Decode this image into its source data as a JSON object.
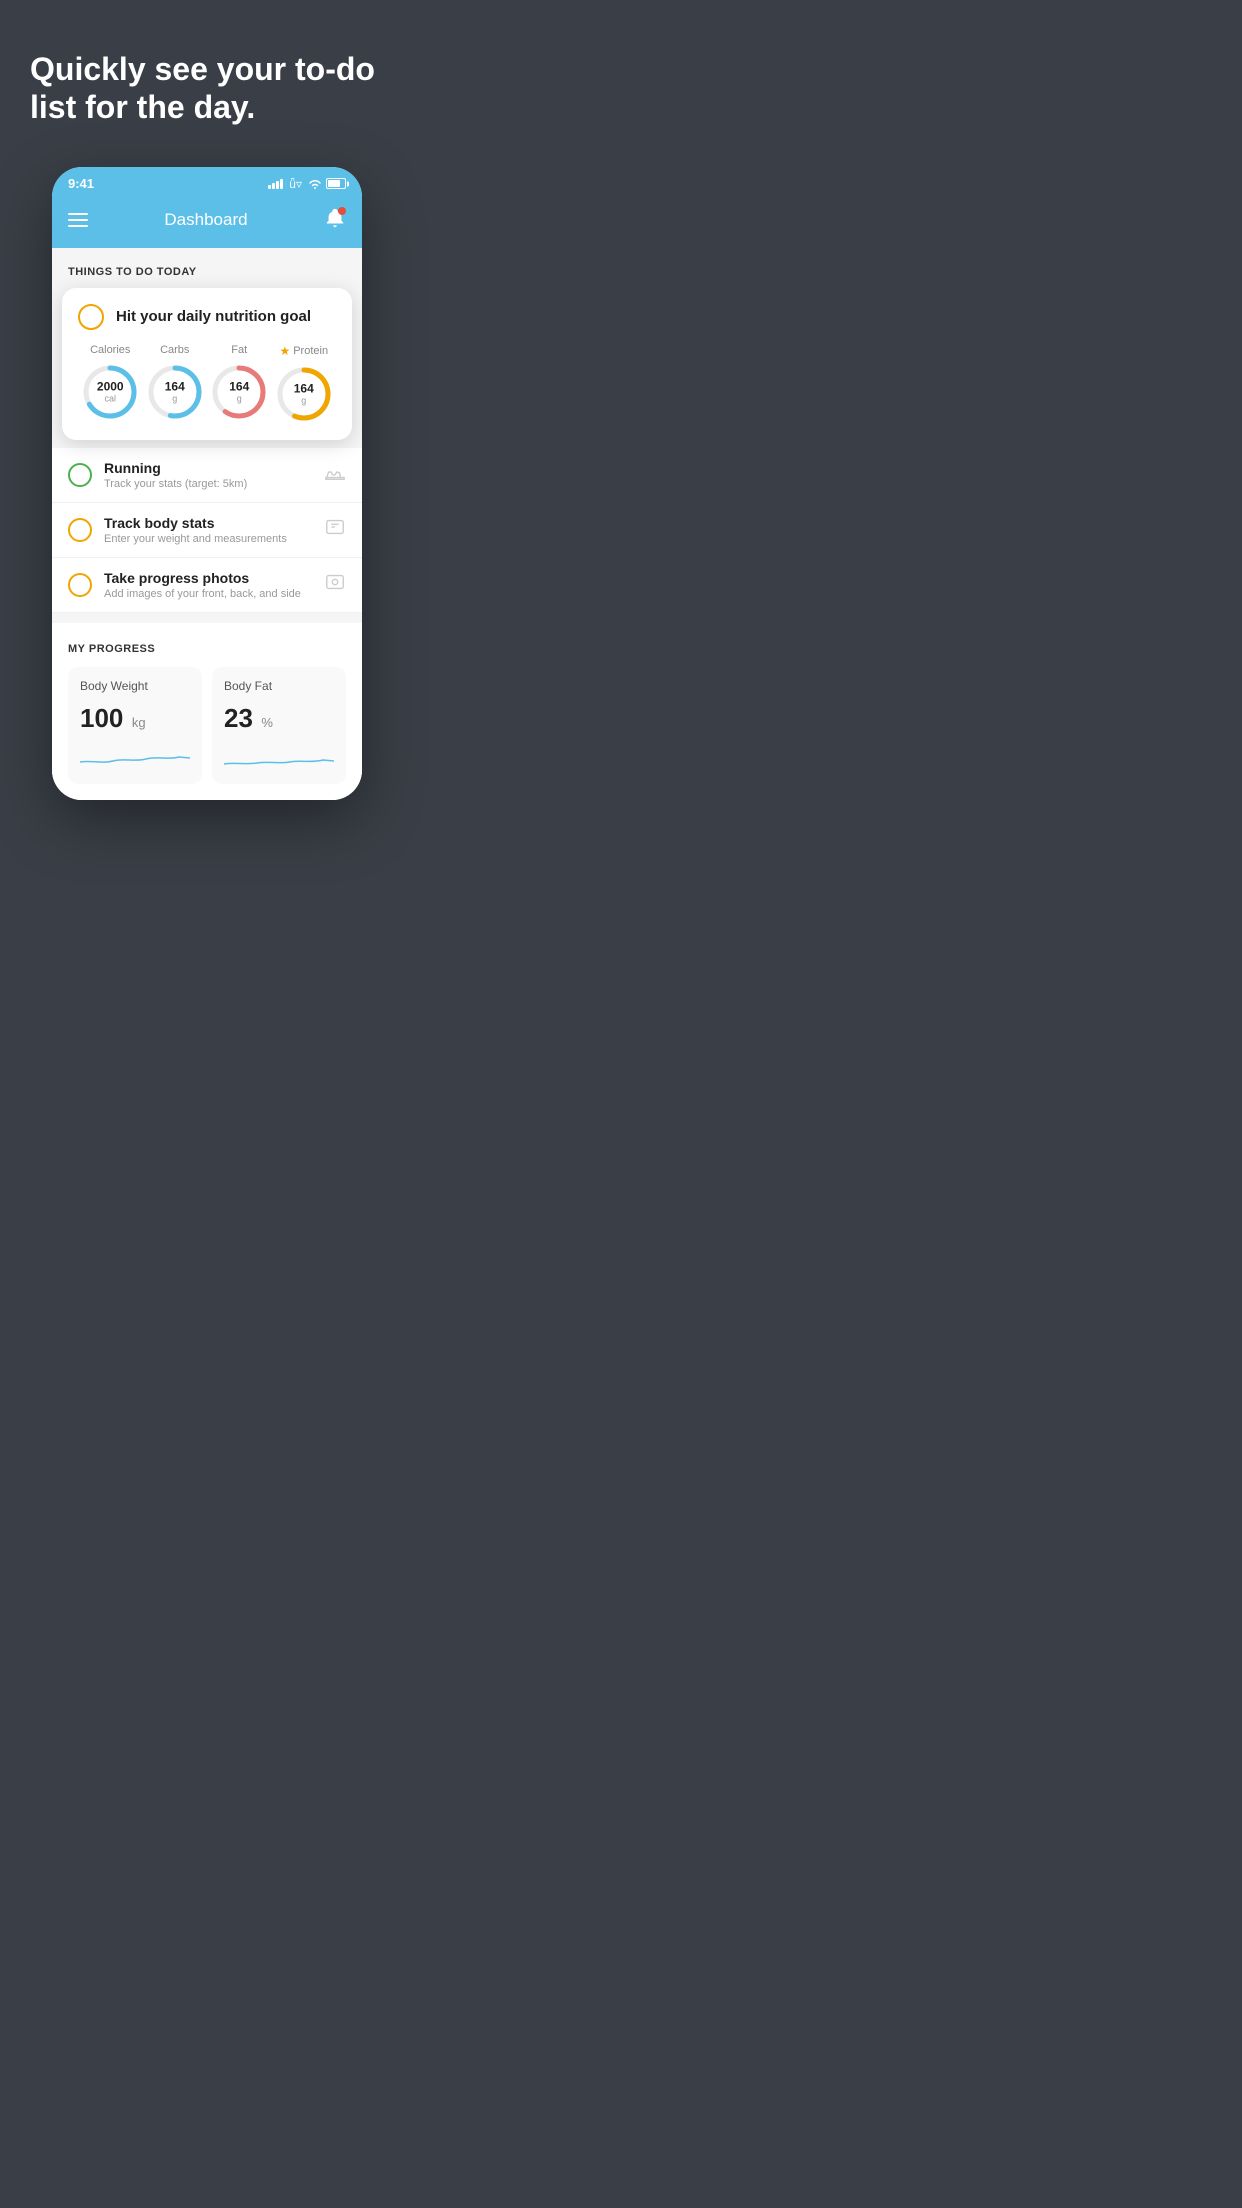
{
  "hero": {
    "text": "Quickly see your to-do list for the day."
  },
  "status_bar": {
    "time": "9:41"
  },
  "header": {
    "title": "Dashboard"
  },
  "things_to_do": {
    "section_label": "THINGS TO DO TODAY",
    "card": {
      "title": "Hit your daily nutrition goal",
      "calories": {
        "label": "Calories",
        "value": "2000",
        "unit": "cal"
      },
      "carbs": {
        "label": "Carbs",
        "value": "164",
        "unit": "g"
      },
      "fat": {
        "label": "Fat",
        "value": "164",
        "unit": "g"
      },
      "protein": {
        "label": "Protein",
        "value": "164",
        "unit": "g"
      }
    },
    "items": [
      {
        "title": "Running",
        "subtitle": "Track your stats (target: 5km)",
        "status": "green",
        "icon": "shoe"
      },
      {
        "title": "Track body stats",
        "subtitle": "Enter your weight and measurements",
        "status": "yellow",
        "icon": "scale"
      },
      {
        "title": "Take progress photos",
        "subtitle": "Add images of your front, back, and side",
        "status": "yellow",
        "icon": "photo"
      }
    ]
  },
  "my_progress": {
    "section_label": "MY PROGRESS",
    "body_weight": {
      "title": "Body Weight",
      "value": "100",
      "unit": "kg"
    },
    "body_fat": {
      "title": "Body Fat",
      "value": "23",
      "unit": "%"
    }
  }
}
